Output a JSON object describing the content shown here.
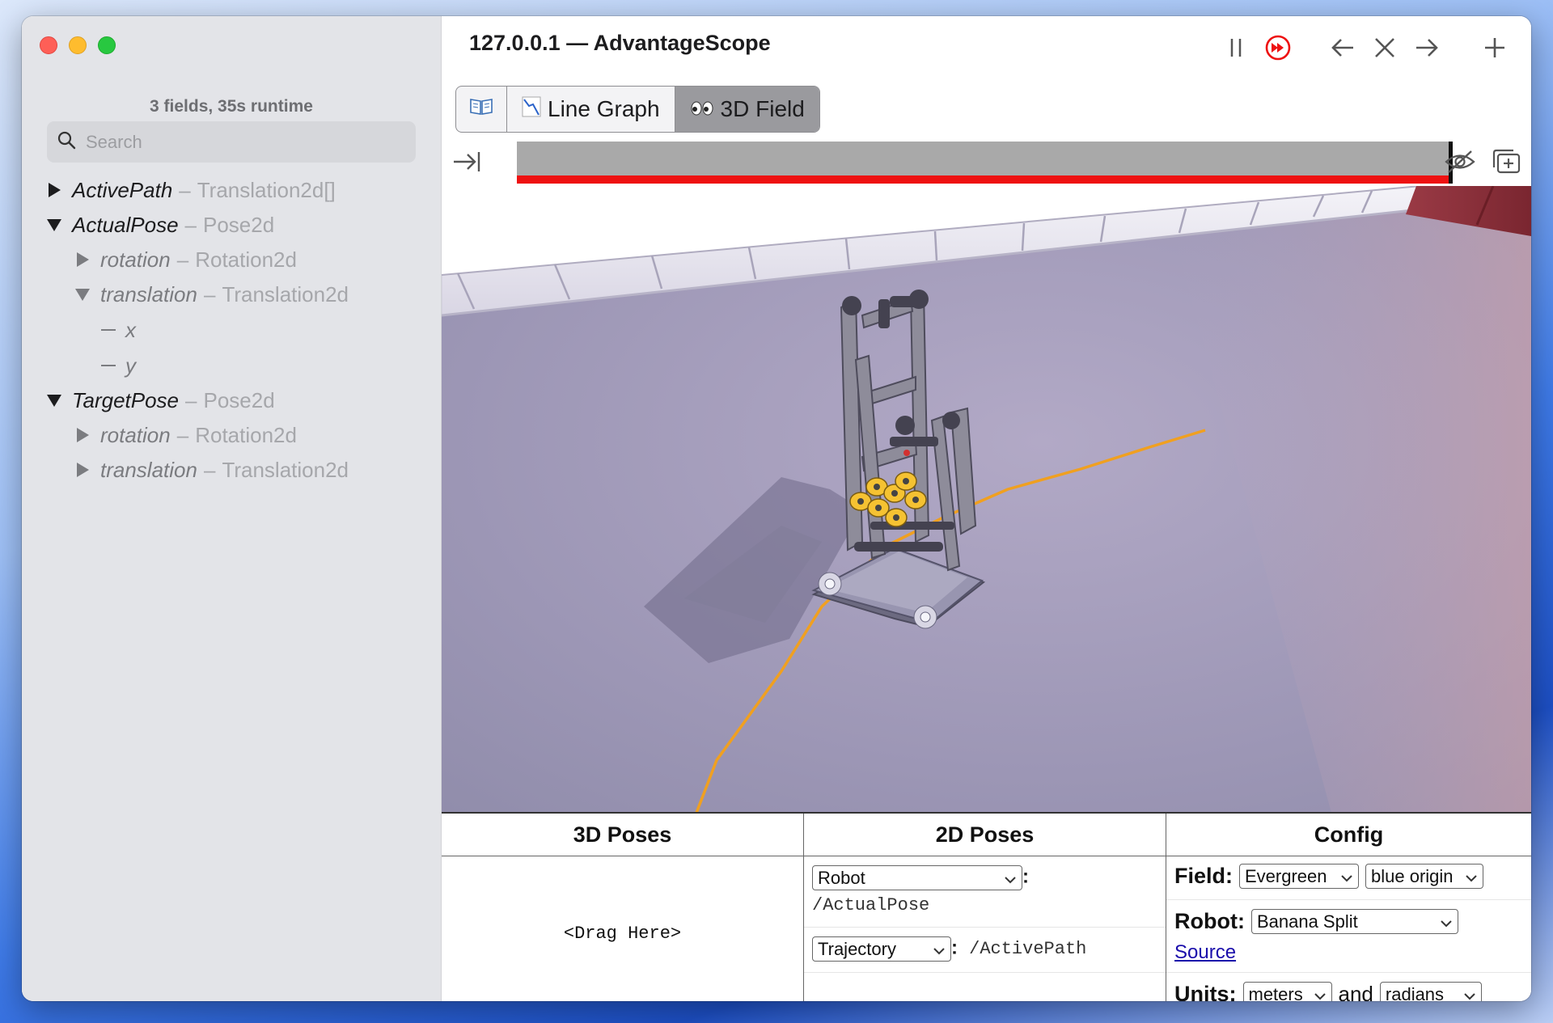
{
  "window": {
    "title": "127.0.0.1 — AdvantageScope"
  },
  "sidebar": {
    "status": "3 fields, 35s runtime",
    "search_placeholder": "Search",
    "tree": [
      {
        "name": "ActivePath",
        "type": "Translation2d[]",
        "expanded": false
      },
      {
        "name": "ActualPose",
        "type": "Pose2d",
        "expanded": true
      },
      {
        "name": "rotation",
        "type": "Rotation2d",
        "expanded": false
      },
      {
        "name": "translation",
        "type": "Translation2d",
        "expanded": true
      },
      {
        "name": "x"
      },
      {
        "name": "y"
      },
      {
        "name": "TargetPose",
        "type": "Pose2d",
        "expanded": true
      },
      {
        "name": "rotation",
        "type": "Rotation2d",
        "expanded": false
      },
      {
        "name": "translation",
        "type": "Translation2d",
        "expanded": false
      }
    ],
    "dash": "–"
  },
  "toolbar": {
    "icons": [
      "pause-icon",
      "live-icon",
      "arrow-left-icon",
      "close-icon",
      "arrow-right-icon",
      "plus-icon"
    ]
  },
  "tabs": [
    {
      "icon": "book-icon",
      "label": ""
    },
    {
      "icon": "chart-icon",
      "label": "Line Graph"
    },
    {
      "icon": "eyes-icon",
      "label": "3D Field",
      "active": true
    }
  ],
  "timeline": {
    "progress_fraction": 1.0
  },
  "controls": {
    "poses3d": {
      "header": "3D Poses",
      "drag_here": "<Drag Here>"
    },
    "poses2d": {
      "header": "2D Poses",
      "rows": [
        {
          "type": "Robot",
          "colon": ":",
          "field": "/ActualPose"
        },
        {
          "type": "Trajectory",
          "colon": ":",
          "field": "/ActivePath"
        }
      ]
    },
    "config": {
      "header": "Config",
      "field_label": "Field:",
      "field_value": "Evergreen",
      "origin_value": "blue origin",
      "robot_label": "Robot:",
      "robot_value": "Banana Split",
      "source_link": "Source",
      "units_label": "Units:",
      "distance_unit": "meters",
      "and_text": "and",
      "angle_unit": "radians"
    }
  },
  "colors": {
    "accent_red": "#ee1111",
    "trajectory": "#f0a020"
  }
}
